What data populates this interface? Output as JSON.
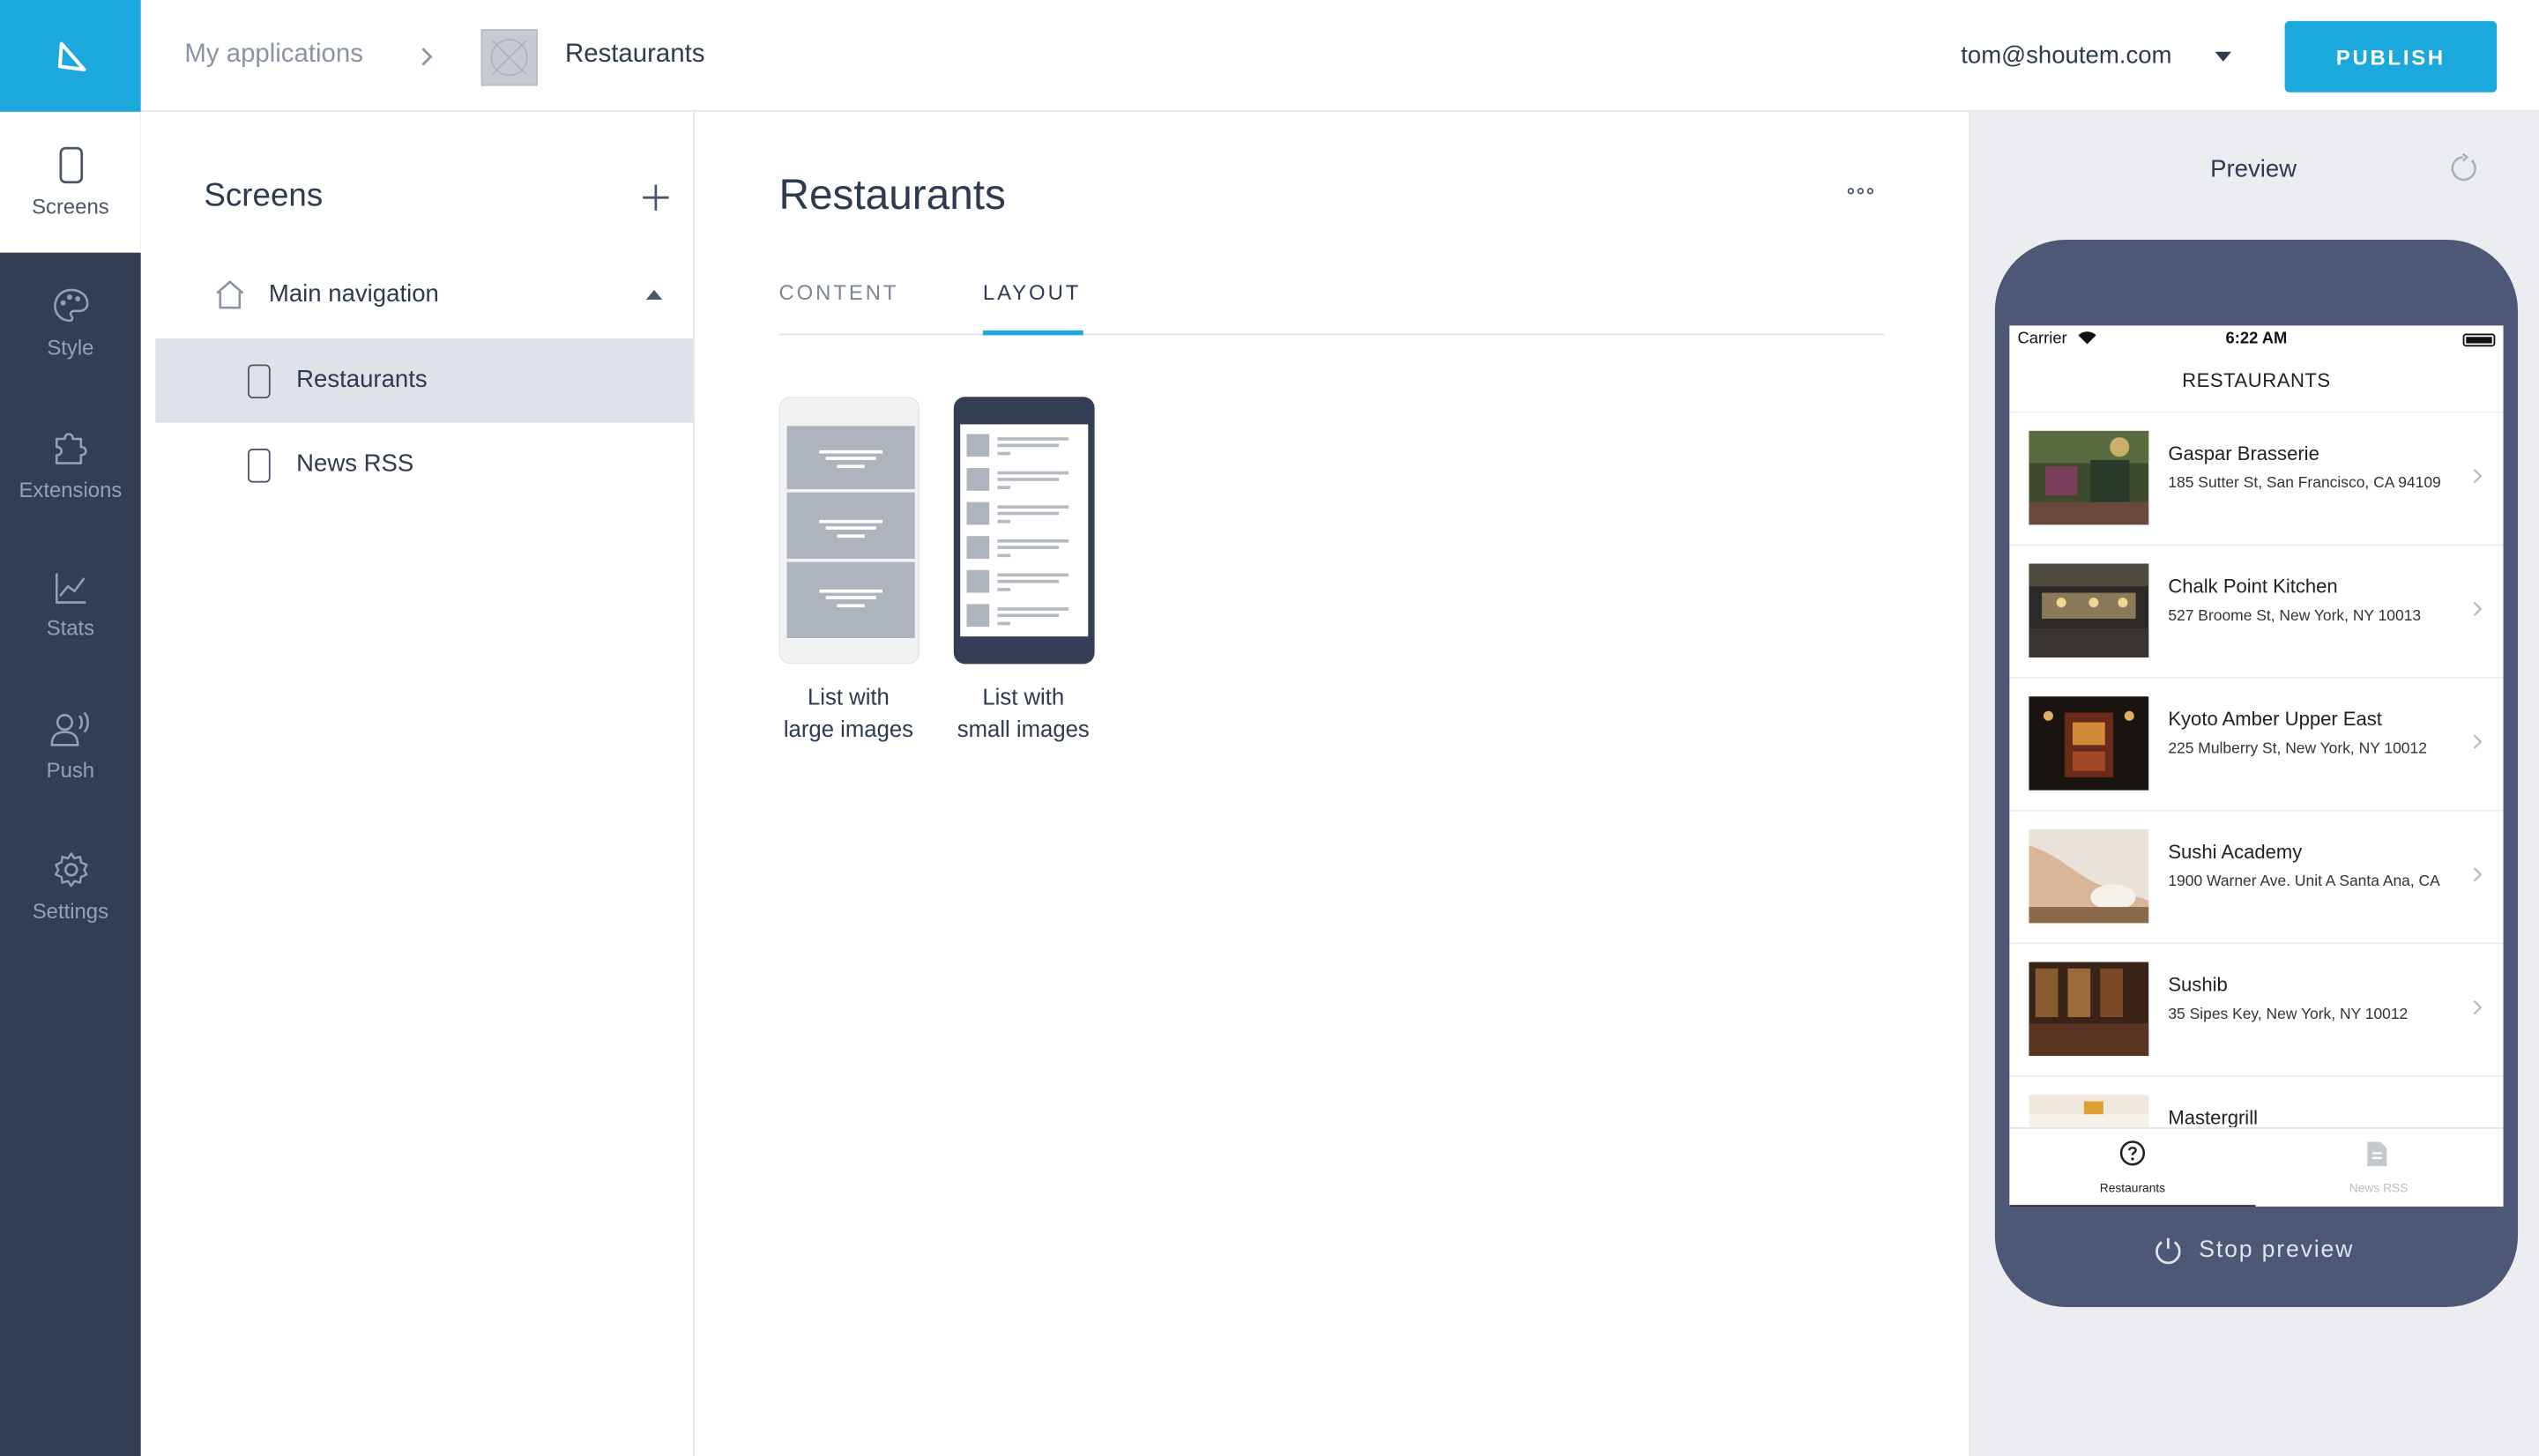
{
  "topbar": {
    "breadcrumb_root": "My applications",
    "breadcrumb_current": "Restaurants",
    "user_email": "tom@shoutem.com",
    "publish_label": "PUBLISH"
  },
  "rail": {
    "items": [
      {
        "label": "Screens",
        "icon": "phone-icon"
      },
      {
        "label": "Style",
        "icon": "palette-icon"
      },
      {
        "label": "Extensions",
        "icon": "puzzle-icon"
      },
      {
        "label": "Stats",
        "icon": "chart-icon"
      },
      {
        "label": "Push",
        "icon": "push-icon"
      },
      {
        "label": "Settings",
        "icon": "gear-icon"
      }
    ]
  },
  "screens": {
    "title": "Screens",
    "group_label": "Main navigation",
    "items": [
      {
        "label": "Restaurants"
      },
      {
        "label": "News RSS"
      }
    ]
  },
  "editor": {
    "title": "Restaurants",
    "tabs": [
      {
        "label": "CONTENT"
      },
      {
        "label": "LAYOUT"
      }
    ],
    "layouts": [
      {
        "label_line1": "List with",
        "label_line2": "large images"
      },
      {
        "label_line1": "List with",
        "label_line2": "small images"
      }
    ]
  },
  "preview": {
    "title": "Preview",
    "status": {
      "carrier": "Carrier",
      "time": "6:22 AM"
    },
    "nav_title": "RESTAURANTS",
    "items": [
      {
        "name": "Gaspar Brasserie",
        "address": "185 Sutter St, San Francisco, CA 94109"
      },
      {
        "name": "Chalk Point Kitchen",
        "address": "527 Broome St, New York, NY 10013"
      },
      {
        "name": "Kyoto Amber Upper East",
        "address": "225 Mulberry St, New York, NY 10012"
      },
      {
        "name": "Sushi Academy",
        "address": "1900 Warner Ave. Unit A Santa Ana, CA"
      },
      {
        "name": "Sushib",
        "address": "35 Sipes Key, New York, NY 10012"
      },
      {
        "name": "Mastergrill",
        "address": ""
      }
    ],
    "tabbar": [
      {
        "label": "Restaurants"
      },
      {
        "label": "News RSS"
      }
    ],
    "stop_label": "Stop preview"
  },
  "colors": {
    "accent": "#1aa8dd",
    "rail_bg": "#333e54",
    "device_bg": "#4c5876"
  }
}
